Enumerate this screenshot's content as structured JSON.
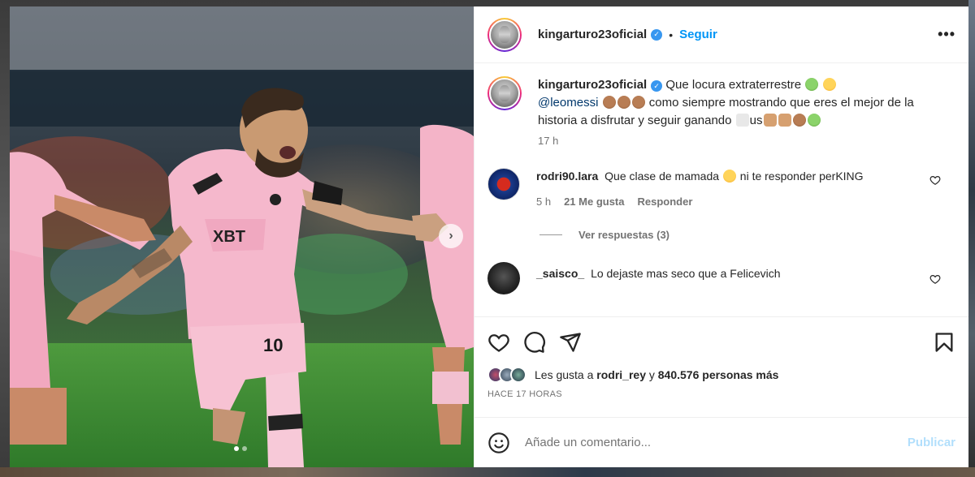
{
  "post": {
    "author": "kingarturo23oficial",
    "follow_label": "Seguir",
    "more_label": "•••",
    "separator": "•",
    "verified_mark": "✓"
  },
  "caption": {
    "username": "kingarturo23oficial",
    "text_part1": "Que locura extraterrestre",
    "mention": "@leomessi",
    "text_part2": "como siempre mostrando que eres el mejor de la historia a disfrutar y seguir ganando",
    "text_part3": "us",
    "time": "17 h"
  },
  "comments": [
    {
      "username": "rodri90.lara",
      "text": "Que clase de mamada",
      "text_after": "ni te responder perKING",
      "time": "5 h",
      "likes": "21 Me gusta",
      "reply_label": "Responder",
      "view_replies": "Ver respuestas (3)"
    },
    {
      "username": "_saisco_",
      "text": "Lo dejaste mas seco que a Felicevich"
    }
  ],
  "likes": {
    "prefix": "Les gusta a",
    "user": "rodri_rey",
    "conj": "y",
    "count": "840.576 personas más",
    "timestamp": "HACE 17 HORAS"
  },
  "composer": {
    "placeholder": "Añade un comentario...",
    "publish_label": "Publicar"
  },
  "carousel": {
    "next_glyph": "›",
    "slides": 2,
    "active_slide": 1
  },
  "icons": {
    "like": "heart-icon",
    "comment": "comment-icon",
    "share": "share-icon",
    "save": "bookmark-icon",
    "emoji": "emoji-icon"
  },
  "colors": {
    "accent": "#0095f6",
    "publish_disabled": "#b2dffc",
    "verified": "#3897f0",
    "jersey_pink": "#f4b4c8"
  }
}
